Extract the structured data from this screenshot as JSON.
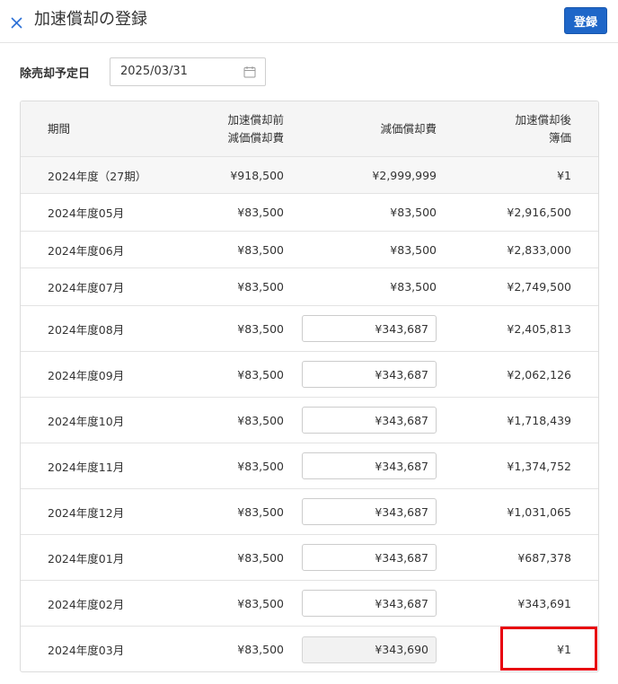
{
  "header": {
    "title": "加速償却の登録",
    "register_label": "登録"
  },
  "date_field": {
    "label": "除売却予定日",
    "value": "2025/03/31"
  },
  "table": {
    "headers": {
      "period": "期間",
      "before_line1": "加速償却前",
      "before_line2": "減価償却費",
      "depreciation": "減価償却費",
      "after_line1": "加速償却後",
      "after_line2": "簿価"
    },
    "rows": [
      {
        "period": "2024年度（27期）",
        "before": "¥918,500",
        "depreciation": "¥2,999,999",
        "after": "¥1"
      },
      {
        "period": "2024年度05月",
        "before": "¥83,500",
        "depreciation": "¥83,500",
        "after": "¥2,916,500"
      },
      {
        "period": "2024年度06月",
        "before": "¥83,500",
        "depreciation": "¥83,500",
        "after": "¥2,833,000"
      },
      {
        "period": "2024年度07月",
        "before": "¥83,500",
        "depreciation": "¥83,500",
        "after": "¥2,749,500"
      },
      {
        "period": "2024年度08月",
        "before": "¥83,500",
        "depreciation": "¥343,687",
        "after": "¥2,405,813"
      },
      {
        "period": "2024年度09月",
        "before": "¥83,500",
        "depreciation": "¥343,687",
        "after": "¥2,062,126"
      },
      {
        "period": "2024年度10月",
        "before": "¥83,500",
        "depreciation": "¥343,687",
        "after": "¥1,718,439"
      },
      {
        "period": "2024年度11月",
        "before": "¥83,500",
        "depreciation": "¥343,687",
        "after": "¥1,374,752"
      },
      {
        "period": "2024年度12月",
        "before": "¥83,500",
        "depreciation": "¥343,687",
        "after": "¥1,031,065"
      },
      {
        "period": "2024年度01月",
        "before": "¥83,500",
        "depreciation": "¥343,687",
        "after": "¥687,378"
      },
      {
        "period": "2024年度02月",
        "before": "¥83,500",
        "depreciation": "¥343,687",
        "after": "¥343,691"
      },
      {
        "period": "2024年度03月",
        "before": "¥83,500",
        "depreciation": "¥343,690",
        "after": "¥1"
      }
    ]
  },
  "colors": {
    "accent": "#1e66c8",
    "highlight": "#e8000f"
  }
}
